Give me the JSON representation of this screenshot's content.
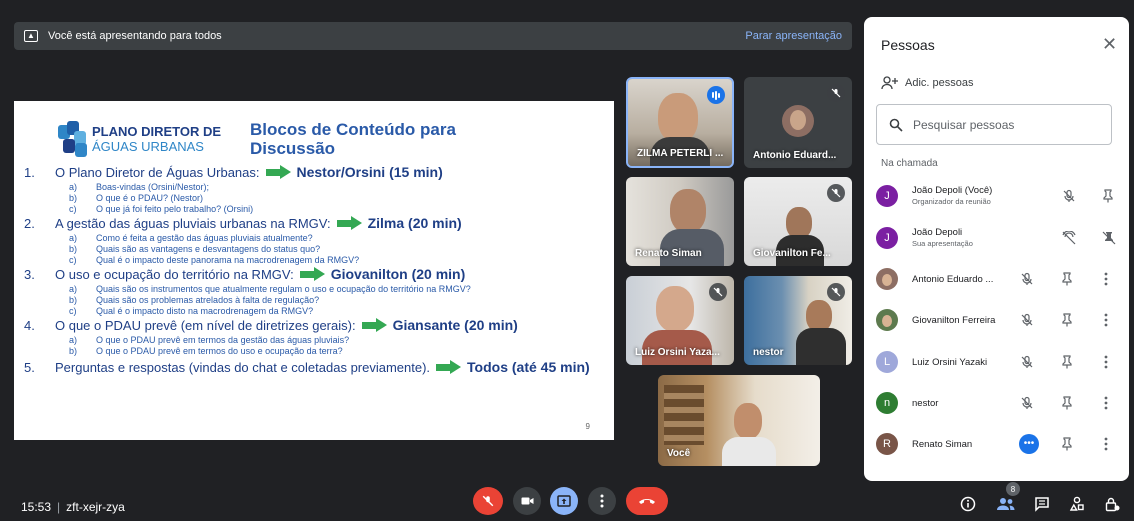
{
  "presenting_bar": {
    "message": "Você está apresentando para todos",
    "stop_label": "Parar apresentação"
  },
  "slide": {
    "logo_line1": "PLANO DIRETOR DE",
    "logo_line2": "ÁGUAS URBANAS",
    "title": "Blocos de Conteúdo para Discussão",
    "items": [
      {
        "num": "1.",
        "text": "O Plano Diretor de Águas Urbanas:",
        "who": "Nestor/Orsini (15 min)",
        "subs": [
          {
            "l": "a)",
            "t": "Boas-vindas (Orsini/Nestor);"
          },
          {
            "l": "b)",
            "t": "O que é o PDAU? (Nestor)"
          },
          {
            "l": "c)",
            "t": "O que já foi feito pelo trabalho? (Orsini)"
          }
        ]
      },
      {
        "num": "2.",
        "text": "A gestão das águas pluviais urbanas na RMGV:",
        "who": "Zilma (20 min)",
        "subs": [
          {
            "l": "a)",
            "t": "Como é feita a gestão das águas pluviais atualmente?"
          },
          {
            "l": "b)",
            "t": "Quais são as vantagens e desvantagens do status quo?"
          },
          {
            "l": "c)",
            "t": "Qual é o impacto deste panorama na macrodrenagem da RMGV?"
          }
        ]
      },
      {
        "num": "3.",
        "text": "O uso e ocupação do território na RMGV:",
        "who": "Giovanilton (20 min)",
        "subs": [
          {
            "l": "a)",
            "t": "Quais são os instrumentos que atualmente regulam o uso e ocupação do território na RMGV?"
          },
          {
            "l": "b)",
            "t": "Quais são os problemas atrelados à falta de regulação?"
          },
          {
            "l": "c)",
            "t": "Qual é o impacto disto na macrodrenagem da RMGV?"
          }
        ]
      },
      {
        "num": "4.",
        "text": "O que o PDAU prevê (em nível de diretrizes gerais):",
        "who": "Giansante (20 min)",
        "subs": [
          {
            "l": "a)",
            "t": "O que o PDAU prevê em termos da gestão das águas pluviais?"
          },
          {
            "l": "b)",
            "t": "O que o PDAU prevê em termos do uso e ocupação da terra?"
          }
        ]
      },
      {
        "num": "5.",
        "text": "Perguntas e respostas (vindas do chat e coletadas previamente).",
        "who": "Todos (até 45 min)",
        "subs": []
      }
    ],
    "page_number": "9"
  },
  "tiles": [
    {
      "name": "ZILMA PETERLI ...",
      "state": "speaking"
    },
    {
      "name": "Antonio Eduard...",
      "state": "muted"
    },
    {
      "name": "Renato Siman",
      "state": "none"
    },
    {
      "name": "Giovanilton Fe...",
      "state": "muted"
    },
    {
      "name": "Luiz Orsini Yaza...",
      "state": "muted"
    },
    {
      "name": "nestor",
      "state": "muted"
    },
    {
      "name": "Você",
      "state": "none"
    }
  ],
  "people_panel": {
    "title": "Pessoas",
    "add_label": "Adic. pessoas",
    "search_placeholder": "Pesquisar pessoas",
    "section_label": "Na chamada",
    "people": [
      {
        "initial": "J",
        "name": "João Depoli (Você)",
        "sub": "Organizador da reunião",
        "color": "#7b1fa2"
      },
      {
        "initial": "J",
        "name": "João Depoli",
        "sub": "Sua apresentação",
        "color": "#7b1fa2"
      },
      {
        "initial": "",
        "name": "Antonio Eduardo ...",
        "sub": "",
        "color": "#8d6e63"
      },
      {
        "initial": "",
        "name": "Giovanilton Ferreira",
        "sub": "",
        "color": "#5d7a4e"
      },
      {
        "initial": "L",
        "name": "Luiz Orsini Yazaki",
        "sub": "",
        "color": "#9fa8da"
      },
      {
        "initial": "n",
        "name": "nestor",
        "sub": "",
        "color": "#2e7d32"
      },
      {
        "initial": "R",
        "name": "Renato Siman",
        "sub": "",
        "color": "#795548"
      }
    ]
  },
  "bottom_bar": {
    "time": "15:53",
    "meeting_code": "zft-xejr-zya",
    "participants_count": "8"
  },
  "colors": {
    "accent_blue": "#8ab4f8",
    "end_call_red": "#ea4335",
    "present_blue": "#8ab4f8",
    "arrow_green": "#34a853"
  }
}
